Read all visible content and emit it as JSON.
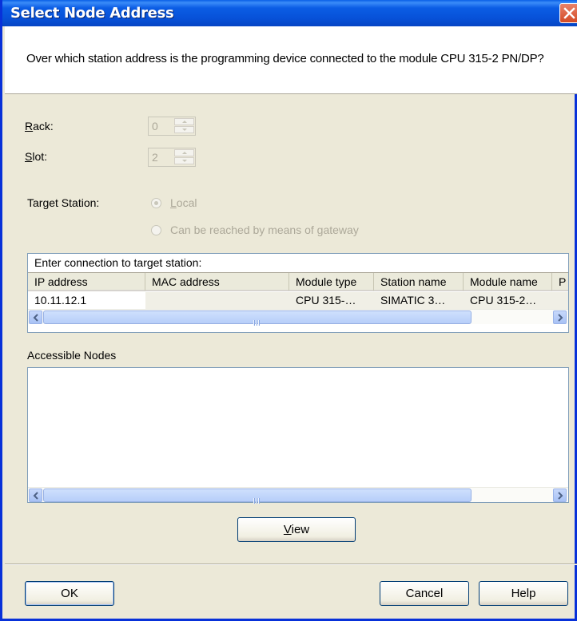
{
  "window": {
    "title": "Select Node Address",
    "prompt": "Over which station address is the programming device connected to the module CPU 315-2 PN/DP?"
  },
  "rack": {
    "label_first": "R",
    "label_rest": "ack:",
    "value": "0"
  },
  "slot": {
    "label_first": "S",
    "label_rest": "lot:",
    "value": "2"
  },
  "target_station": {
    "label": "Target Station:",
    "options": [
      {
        "label_first": "L",
        "label_rest": "ocal",
        "selected": true
      },
      {
        "label": "Can be reached by means of gateway",
        "selected": false
      }
    ]
  },
  "connection_table": {
    "caption": "Enter connection to target station:",
    "columns": [
      "IP address",
      "MAC address",
      "Module type",
      "Station name",
      "Module name",
      "P"
    ],
    "rows": [
      [
        "10.11.12.1",
        "",
        "CPU 315-…",
        "SIMATIC 3…",
        "CPU 315-2…",
        ""
      ]
    ]
  },
  "accessible_nodes": {
    "label": "Accessible Nodes",
    "items": []
  },
  "buttons": {
    "view_first": "V",
    "view_rest": "iew",
    "ok": "OK",
    "cancel": "Cancel",
    "help": "Help"
  },
  "icons": {
    "close": "close-icon",
    "scroll_left": "arrow-left-icon",
    "scroll_right": "arrow-right-icon"
  },
  "colors": {
    "titlebar": "#0751d8",
    "dialog_bg": "#ece9d8",
    "close_button": "#d34a24"
  }
}
